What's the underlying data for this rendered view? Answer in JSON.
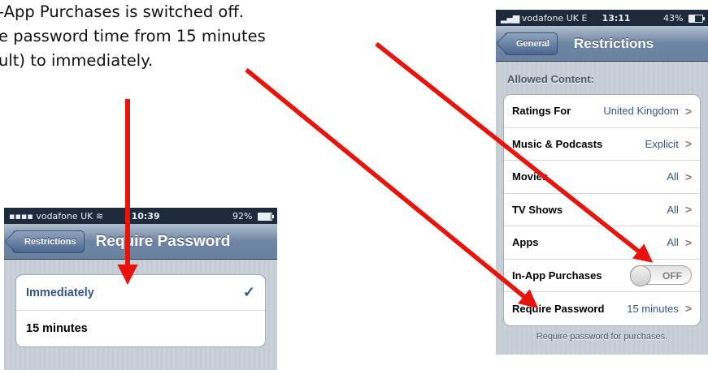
{
  "caption": {
    "line1": "-App Purchases is switched off.",
    "line2": "e password time from 15 minutes",
    "line3": "ult) to immediately."
  },
  "right_phone": {
    "status": {
      "carrier": "vodafone UK  E",
      "time": "13:11",
      "battery": "43%",
      "battery_level": 0.43
    },
    "nav": {
      "back_label": "General",
      "title": "Restrictions"
    },
    "section_header": "Allowed Content:",
    "rows": [
      {
        "label": "Ratings For",
        "value": "United Kingdom",
        "chevron": ">"
      },
      {
        "label": "Music & Podcasts",
        "value": "Explicit",
        "chevron": ">"
      },
      {
        "label": "Movies",
        "value": "All",
        "chevron": ">"
      },
      {
        "label": "TV Shows",
        "value": "All",
        "chevron": ">"
      },
      {
        "label": "Apps",
        "value": "All",
        "chevron": ">"
      },
      {
        "label": "In-App Purchases",
        "toggle": "OFF"
      },
      {
        "label": "Require Password",
        "value": "15 minutes",
        "chevron": ">"
      }
    ],
    "footer": "Require password for purchases."
  },
  "left_phone": {
    "status": {
      "carrier": "vodafone UK",
      "time": "10:39",
      "battery": "92%",
      "battery_level": 0.92
    },
    "nav": {
      "back_label": "Restrictions",
      "title": "Require Password"
    },
    "options": [
      {
        "label": "Immediately",
        "check": "✓"
      },
      {
        "label": "15 minutes"
      }
    ]
  },
  "colors": {
    "arrow": "#e8140c",
    "value_blue": "#385487",
    "nav_blue": "#6d84a2"
  }
}
